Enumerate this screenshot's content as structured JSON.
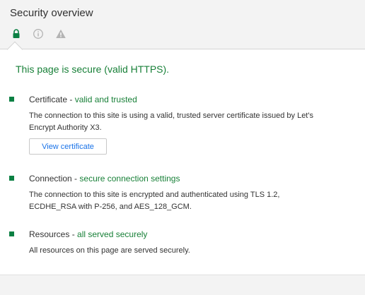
{
  "header": {
    "title": "Security overview"
  },
  "summary": "This page is secure (valid HTTPS).",
  "sections": [
    {
      "label": "Certificate",
      "separator": " - ",
      "detail": "valid and trusted",
      "description": "The connection to this site is using a valid, trusted server certificate issued by Let's Encrypt Authority X3.",
      "button_label": "View certificate"
    },
    {
      "label": "Connection",
      "separator": " - ",
      "detail": "secure connection settings",
      "description": "The connection to this site is encrypted and authenticated using TLS 1.2, ECDHE_RSA with P-256, and AES_128_GCM."
    },
    {
      "label": "Resources",
      "separator": " - ",
      "detail": "all served securely",
      "description": "All resources on this page are served securely."
    }
  ],
  "colors": {
    "secure": "#188038",
    "link": "#1a73e8"
  },
  "icons": {
    "tab_secure": "lock-icon",
    "tab_info": "info-icon",
    "tab_warning": "warning-icon"
  }
}
